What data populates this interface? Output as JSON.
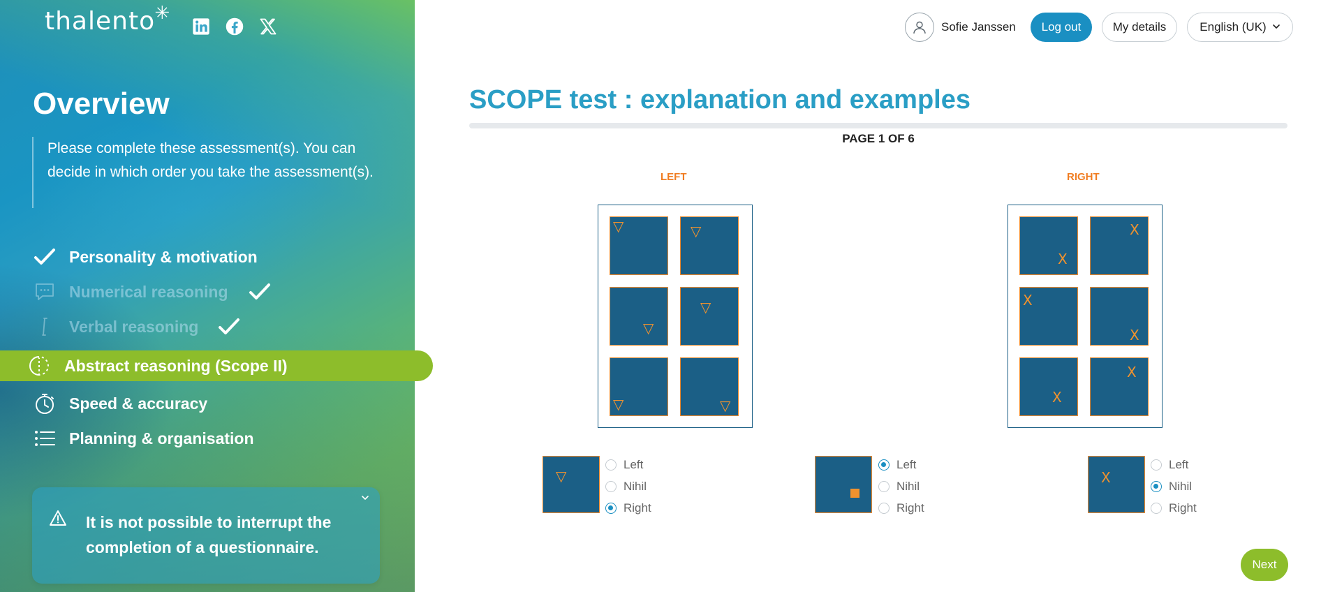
{
  "brand": {
    "logo_text": "thalento"
  },
  "social": [
    {
      "icon": "linkedin-icon"
    },
    {
      "icon": "facebook-icon"
    },
    {
      "icon": "x-twitter-icon"
    }
  ],
  "sidebar": {
    "title": "Overview",
    "intro": "Please complete these assessment(s). You can decide in which order you take the assessment(s).",
    "items": [
      {
        "label": "Personality & motivation",
        "icon": "check-icon",
        "state": "done"
      },
      {
        "label": "Numerical reasoning",
        "icon": "speech-bubble-icon",
        "state": "done-dim"
      },
      {
        "label": "Verbal reasoning",
        "icon": "text-cursor-icon",
        "state": "done-dim"
      },
      {
        "label": "Abstract reasoning (Scope II)",
        "icon": "half-circle-icon",
        "state": "active"
      },
      {
        "label": "Speed & accuracy",
        "icon": "stopwatch-icon",
        "state": "todo"
      },
      {
        "label": "Planning & organisation",
        "icon": "list-icon",
        "state": "todo"
      }
    ],
    "warning": "It is not possible to interrupt the completion of a questionnaire."
  },
  "header": {
    "user_name": "Sofie Janssen",
    "logout_label": "Log out",
    "details_label": "My details",
    "language": "English (UK)"
  },
  "main": {
    "title": "SCOPE test : explanation and examples",
    "page_indicator": "PAGE 1 OF 6",
    "left_label": "LEFT",
    "right_label": "RIGHT",
    "left_symbol": "triangle-down",
    "right_symbol": "X",
    "examples": [
      {
        "symbol": "triangle",
        "options": [
          "Left",
          "Nihil",
          "Right"
        ],
        "selected": "Right"
      },
      {
        "symbol": "square",
        "options": [
          "Left",
          "Nihil",
          "Right"
        ],
        "selected": "Left"
      },
      {
        "symbol": "X",
        "options": [
          "Left",
          "Nihil",
          "Right"
        ],
        "selected": "Nihil"
      }
    ],
    "next_label": "Next"
  },
  "colors": {
    "accent_blue": "#2a9ec5",
    "button_blue": "#1a8fc2",
    "accent_green": "#8dbd2b",
    "cell_fill": "#1b5f86",
    "mark_orange": "#f0922e"
  }
}
